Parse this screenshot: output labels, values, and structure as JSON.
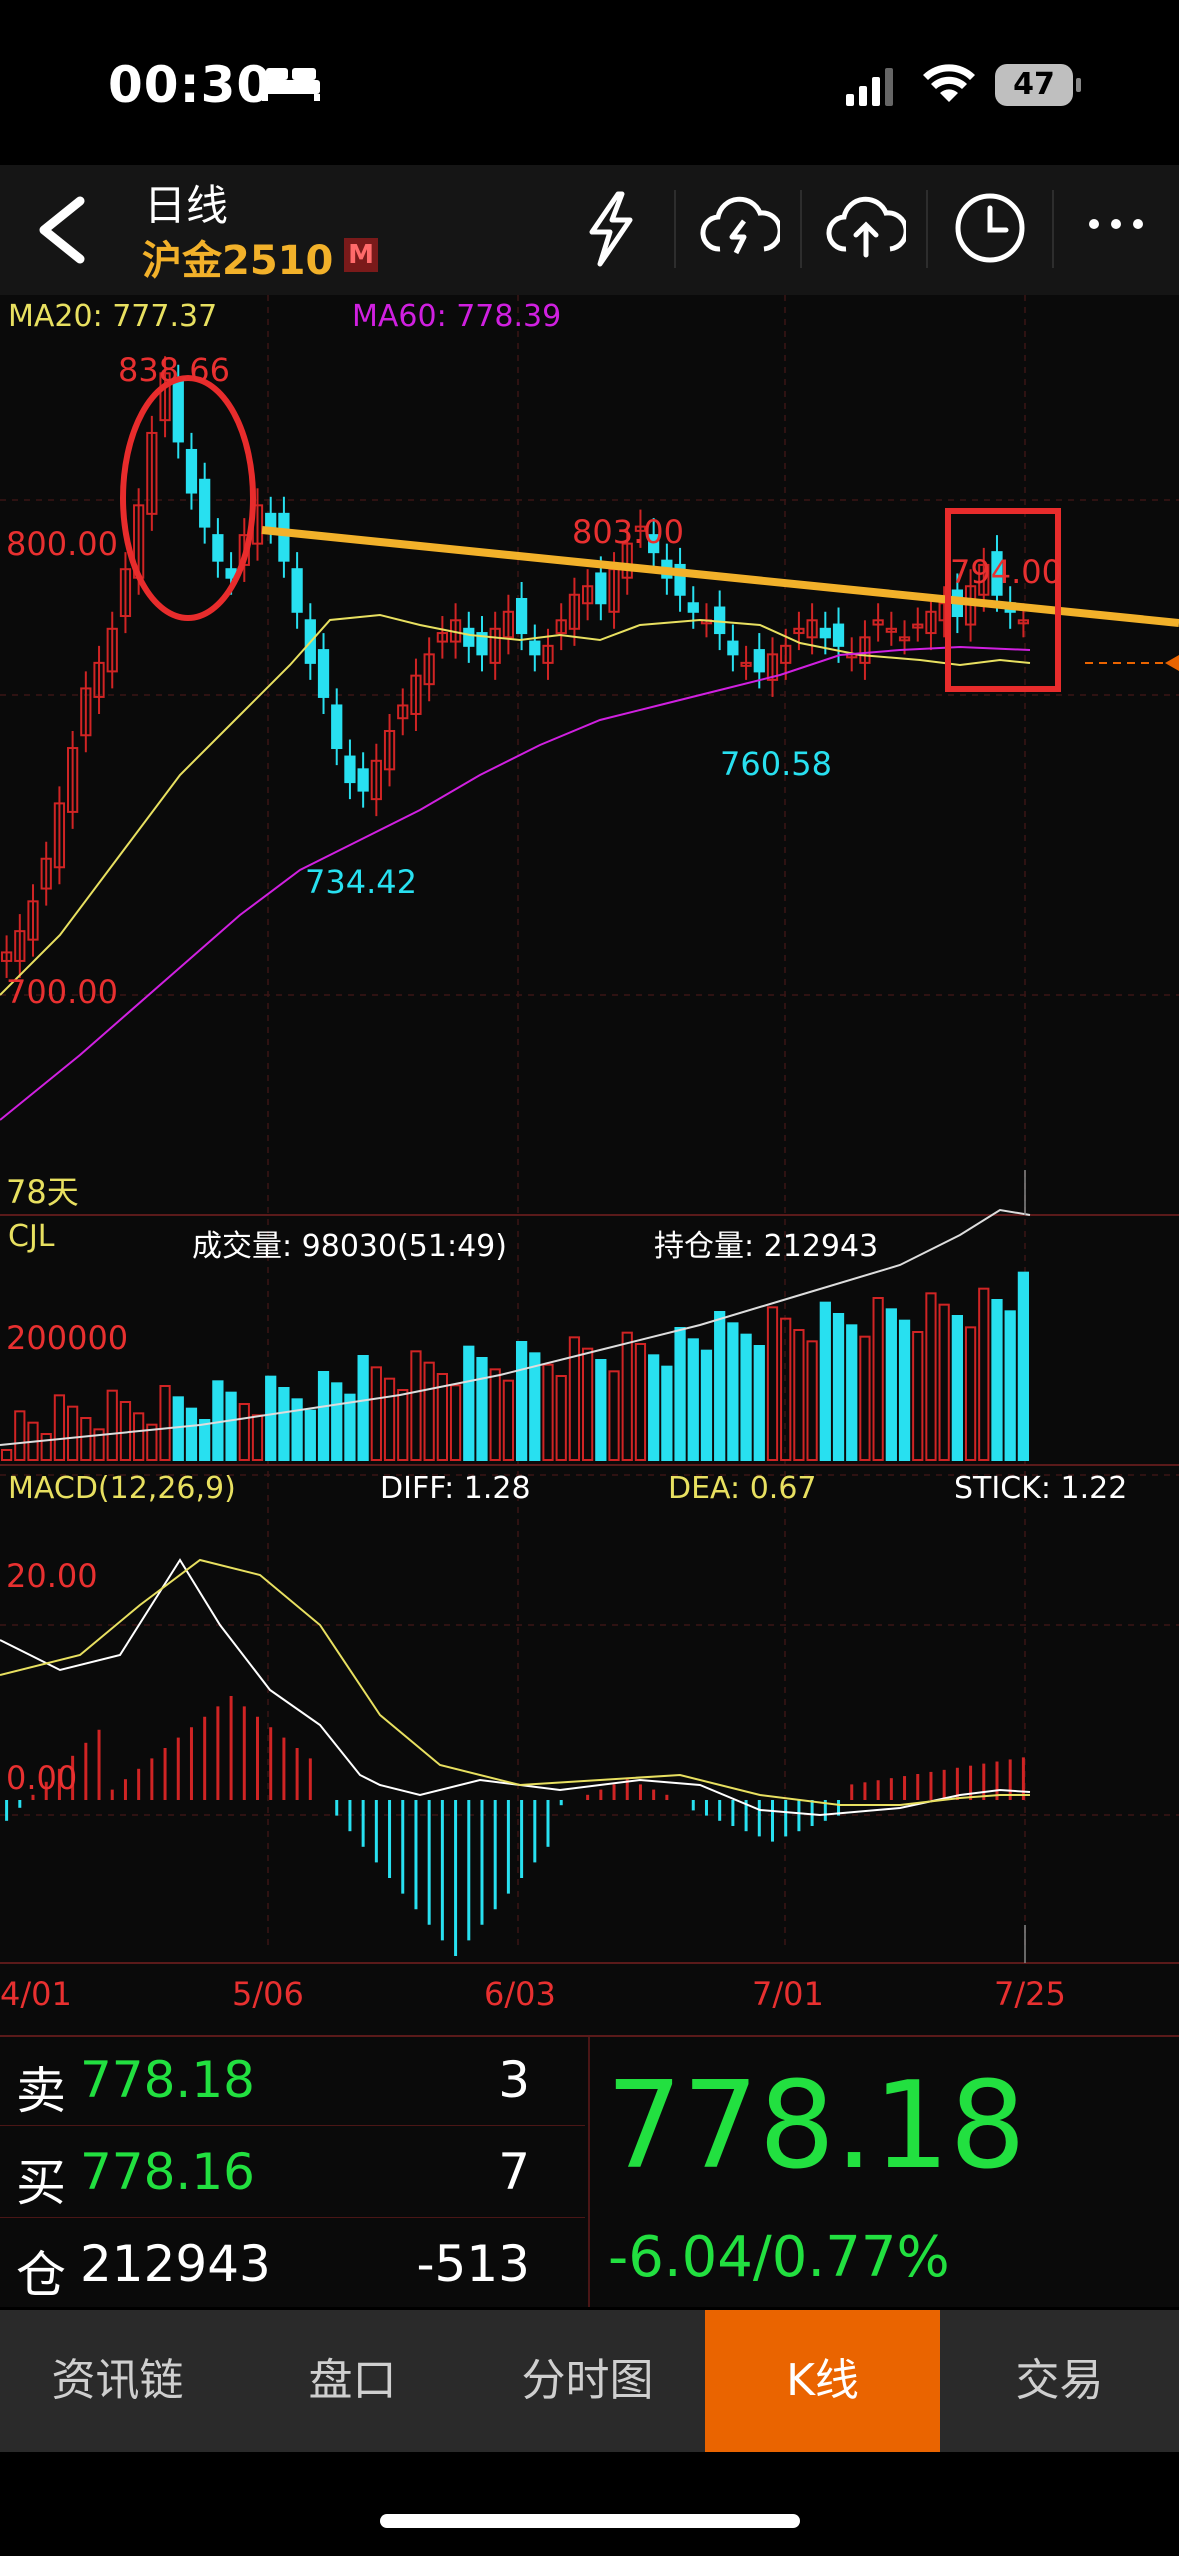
{
  "status_bar": {
    "time": "00:30",
    "battery": "47"
  },
  "header": {
    "period": "日线",
    "symbol": "沪金2510",
    "market_badge": "M",
    "icons": [
      "lightning-icon",
      "cloud-sync-icon",
      "cloud-upload-icon",
      "clock-icon",
      "more-icon"
    ]
  },
  "chart": {
    "ma20_label": "MA20: 777.37",
    "ma60_label": "MA60: 778.39",
    "annotations": {
      "high": "838.66",
      "peak2": "803.00",
      "boxed": "794.00",
      "low1": "734.42",
      "low2": "760.58"
    },
    "price_axis": [
      "800.00",
      "700.00"
    ],
    "days_label": "78天",
    "volume": {
      "title": "CJL",
      "volume_label": "成交量: 98030(51:49)",
      "oi_label": "持仓量: 212943",
      "axis": "200000"
    },
    "macd": {
      "title": "MACD(12,26,9)",
      "diff": "DIFF: 1.28",
      "dea": "DEA: 0.67",
      "stick": "STICK: 1.22",
      "axis_top": "20.00",
      "axis_zero": "0.00"
    },
    "dates": [
      "4/01",
      "5/06",
      "6/03",
      "7/01",
      "7/25"
    ]
  },
  "chart_data": {
    "type": "candlestick",
    "title": "沪金2510 日线",
    "ma20": 777.37,
    "ma60": 778.39,
    "labeled_points": [
      {
        "label": "high",
        "value": 838.66
      },
      {
        "label": "peak",
        "value": 803.0
      },
      {
        "label": "recent high",
        "value": 794.0
      },
      {
        "label": "low",
        "value": 734.42
      },
      {
        "label": "low",
        "value": 760.58
      }
    ],
    "ylim": [
      690,
      845
    ],
    "x_ticks": [
      "4/01",
      "5/06",
      "6/03",
      "7/01",
      "7/25"
    ],
    "last_price": 778.18,
    "volume": 98030,
    "open_interest": 212943,
    "macd": {
      "diff": 1.28,
      "dea": 0.67,
      "stick": 1.22
    }
  },
  "quote": {
    "sell_label": "卖",
    "sell_price": "778.18",
    "sell_qty": "3",
    "buy_label": "买",
    "buy_price": "778.16",
    "buy_qty": "7",
    "oi_label": "仓",
    "oi_value": "212943",
    "oi_change": "-513",
    "last_price": "778.18",
    "change": "-6.04/0.77%"
  },
  "tabs": [
    "资讯链",
    "盘口",
    "分时图",
    "K线",
    "交易"
  ],
  "colors": {
    "up": "#d02424",
    "down": "#28e0f0",
    "ma20": "#e8e060",
    "ma60": "#d020e0",
    "accent": "#ea6400",
    "trendline": "#f2b12a"
  }
}
